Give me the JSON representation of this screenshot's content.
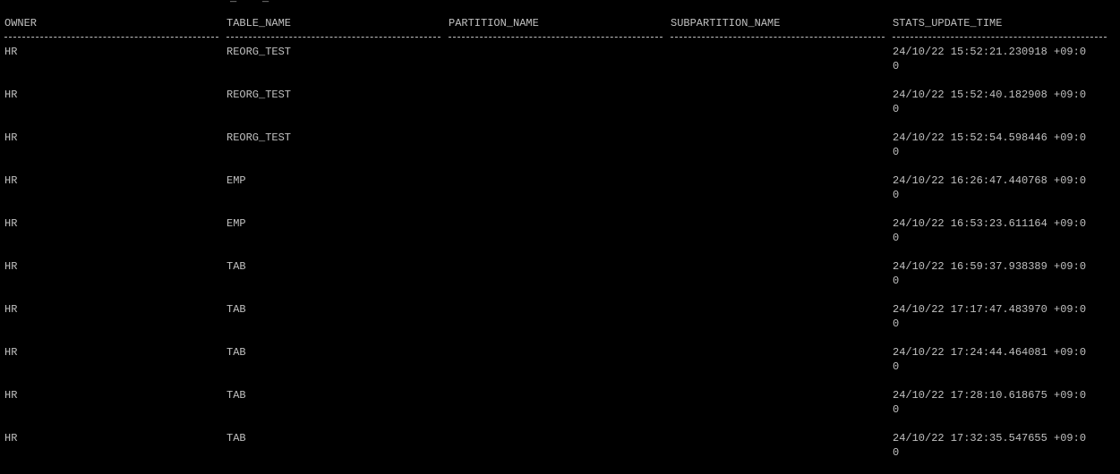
{
  "terminal": {
    "background": "#000000",
    "foreground": "#c0c0c0",
    "partial_top_line": "                                   _    _"
  },
  "table": {
    "columns": [
      "OWNER",
      "TABLE_NAME",
      "PARTITION_NAME",
      "SUBPARTITION_NAME",
      "STATS_UPDATE_TIME"
    ],
    "rows": [
      {
        "owner": "HR",
        "table_name": "REORG_TEST",
        "partition_name": "",
        "subpartition_name": "",
        "stats_update_time": "24/10/22 15:52:21.230918 +09:0",
        "wrap": "0"
      },
      {
        "owner": "HR",
        "table_name": "REORG_TEST",
        "partition_name": "",
        "subpartition_name": "",
        "stats_update_time": "24/10/22 15:52:40.182908 +09:0",
        "wrap": "0"
      },
      {
        "owner": "HR",
        "table_name": "REORG_TEST",
        "partition_name": "",
        "subpartition_name": "",
        "stats_update_time": "24/10/22 15:52:54.598446 +09:0",
        "wrap": "0"
      },
      {
        "owner": "HR",
        "table_name": "EMP",
        "partition_name": "",
        "subpartition_name": "",
        "stats_update_time": "24/10/22 16:26:47.440768 +09:0",
        "wrap": "0"
      },
      {
        "owner": "HR",
        "table_name": "EMP",
        "partition_name": "",
        "subpartition_name": "",
        "stats_update_time": "24/10/22 16:53:23.611164 +09:0",
        "wrap": "0"
      },
      {
        "owner": "HR",
        "table_name": "TAB",
        "partition_name": "",
        "subpartition_name": "",
        "stats_update_time": "24/10/22 16:59:37.938389 +09:0",
        "wrap": "0"
      },
      {
        "owner": "HR",
        "table_name": "TAB",
        "partition_name": "",
        "subpartition_name": "",
        "stats_update_time": "24/10/22 17:17:47.483970 +09:0",
        "wrap": "0"
      },
      {
        "owner": "HR",
        "table_name": "TAB",
        "partition_name": "",
        "subpartition_name": "",
        "stats_update_time": "24/10/22 17:24:44.464081 +09:0",
        "wrap": "0"
      },
      {
        "owner": "HR",
        "table_name": "TAB",
        "partition_name": "",
        "subpartition_name": "",
        "stats_update_time": "24/10/22 17:28:10.618675 +09:0",
        "wrap": "0"
      },
      {
        "owner": "HR",
        "table_name": "TAB",
        "partition_name": "",
        "subpartition_name": "",
        "stats_update_time": "24/10/22 17:32:35.547655 +09:0",
        "wrap": "0"
      }
    ]
  }
}
